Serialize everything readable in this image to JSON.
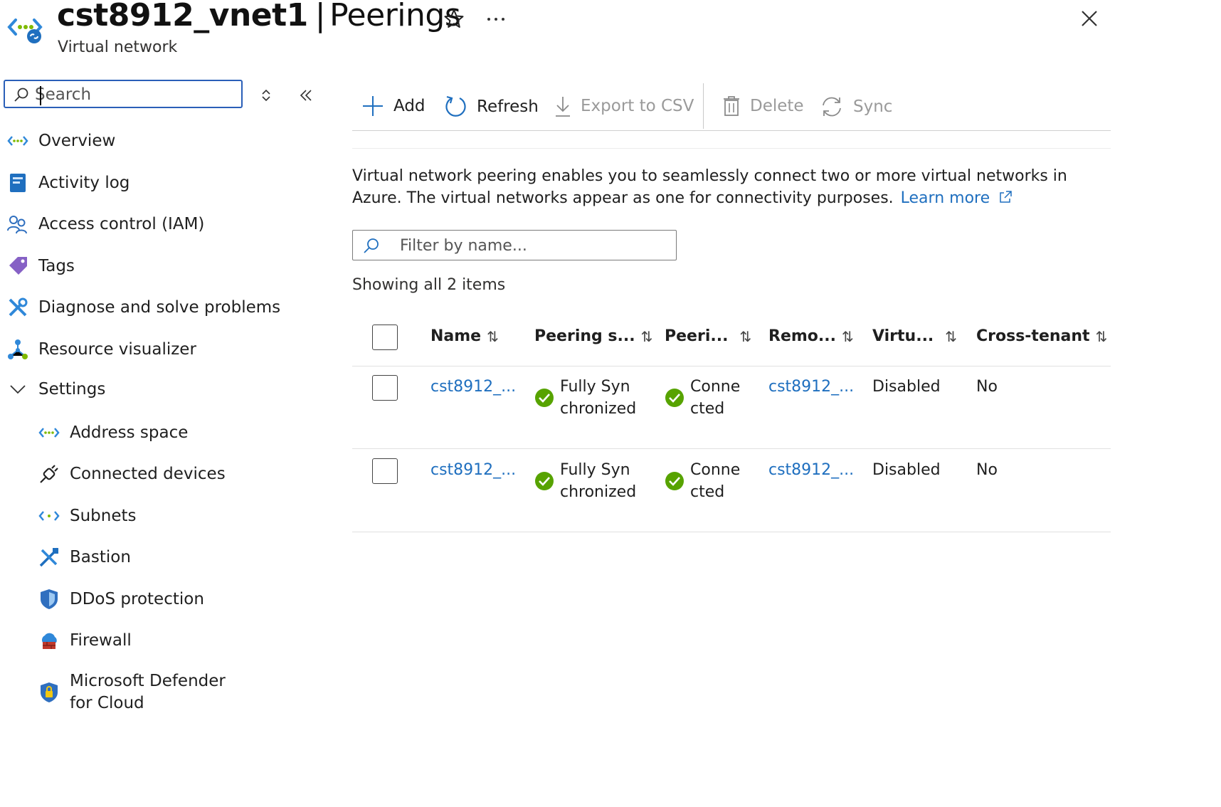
{
  "header": {
    "resource_name": "cst8912_vnet1",
    "separator": "|",
    "blade_title": "Peerings",
    "subtitle": "Virtual network"
  },
  "sidebar": {
    "search_placeholder": "Search",
    "items": [
      {
        "label": "Overview",
        "icon": "vnet-icon"
      },
      {
        "label": "Activity log",
        "icon": "activity-log-icon"
      },
      {
        "label": "Access control (IAM)",
        "icon": "iam-icon"
      },
      {
        "label": "Tags",
        "icon": "tag-icon"
      },
      {
        "label": "Diagnose and solve problems",
        "icon": "wrench-icon"
      },
      {
        "label": "Resource visualizer",
        "icon": "visualizer-icon"
      },
      {
        "label": "Settings",
        "icon": "chevron-down-icon"
      }
    ],
    "settings_items": [
      {
        "label": "Address space",
        "icon": "address-space-icon"
      },
      {
        "label": "Connected devices",
        "icon": "plug-icon"
      },
      {
        "label": "Subnets",
        "icon": "subnet-icon"
      },
      {
        "label": "Bastion",
        "icon": "bastion-icon"
      },
      {
        "label": "DDoS protection",
        "icon": "shield-icon"
      },
      {
        "label": "Firewall",
        "icon": "firewall-icon"
      },
      {
        "label": "Microsoft Defender for Cloud",
        "icon": "defender-icon"
      }
    ]
  },
  "toolbar": {
    "add": "Add",
    "refresh": "Refresh",
    "export": "Export to CSV",
    "delete": "Delete",
    "sync": "Sync"
  },
  "description": {
    "text": "Virtual network peering enables you to seamlessly connect two or more virtual networks in Azure. The virtual networks appear as one for connectivity purposes.",
    "learn_more": "Learn more"
  },
  "filter": {
    "placeholder": "Filter by name..."
  },
  "showing": "Showing all 2 items",
  "table": {
    "columns": [
      "Name",
      "Peering s...",
      "Peeri...",
      "Remo...",
      "Virtu...",
      "Cross-tenant"
    ],
    "rows": [
      {
        "name": "cst8912_...",
        "peering_sync": "Fully Synchronized",
        "peering_state": "Connected",
        "remote": "cst8912_...",
        "virtual_gateway": "Disabled",
        "cross_tenant": "No"
      },
      {
        "name": "cst8912_...",
        "peering_sync": "Fully Synchronized",
        "peering_state": "Connected",
        "remote": "cst8912_...",
        "virtual_gateway": "Disabled",
        "cross_tenant": "No"
      }
    ]
  },
  "colors": {
    "accent": "#1f6fbf",
    "success": "#57a300",
    "focus_border": "#2a5fb8",
    "disabled_text": "#9a9a9a"
  }
}
